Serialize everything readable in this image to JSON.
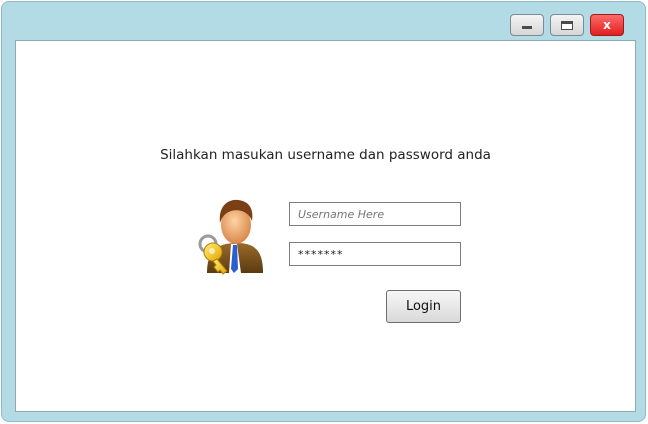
{
  "window": {
    "controls": {
      "minimize_icon": "minimize-icon",
      "maximize_icon": "maximize-icon",
      "close_label": "x"
    }
  },
  "login": {
    "prompt": "Silahkan masukan username dan password anda",
    "username_placeholder": "Username Here",
    "password_value": "*******",
    "button_label": "Login",
    "avatar_icon": "user-key-icon"
  },
  "colors": {
    "window_frame": "#b3dbe6",
    "close_button": "#e21f1f"
  }
}
